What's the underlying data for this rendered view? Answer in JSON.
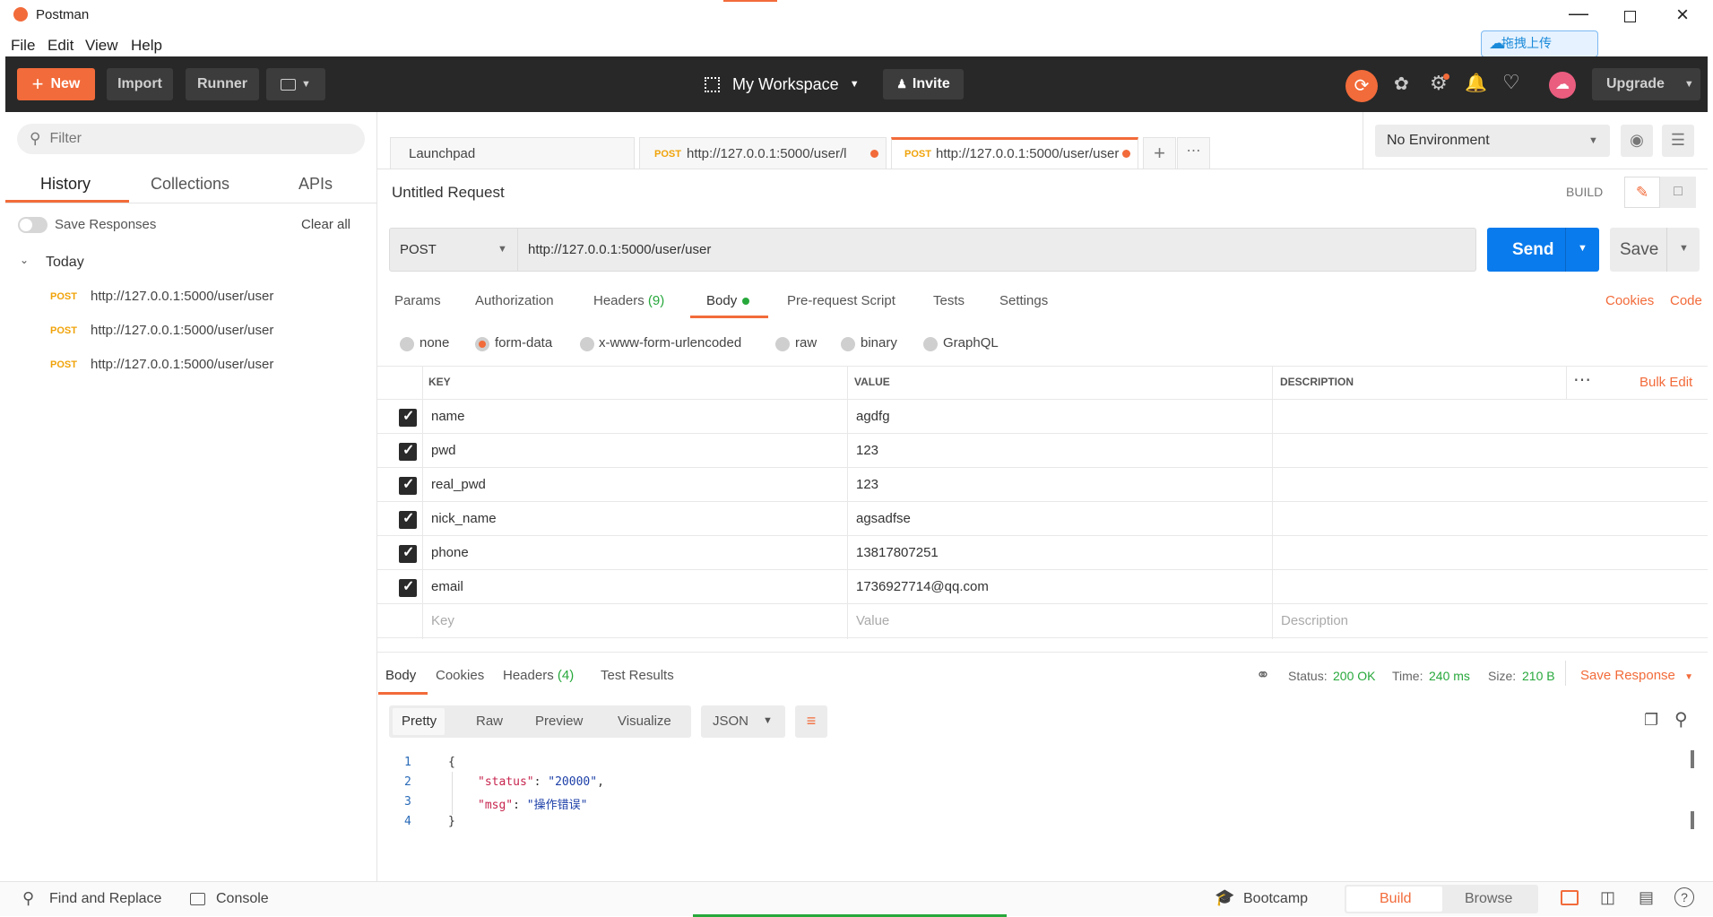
{
  "window": {
    "title": "Postman"
  },
  "menu": [
    "File",
    "Edit",
    "View",
    "Help"
  ],
  "upload_badge": "拖拽上传",
  "toolbar": {
    "new_label": "New",
    "import_label": "Import",
    "runner_label": "Runner",
    "workspace_label": "My Workspace",
    "invite_label": "Invite",
    "upgrade_label": "Upgrade"
  },
  "sidebar": {
    "filter_placeholder": "Filter",
    "tabs": [
      "History",
      "Collections",
      "APIs"
    ],
    "save_responses_label": "Save Responses",
    "clear_all_label": "Clear all",
    "group_label": "Today",
    "history": [
      {
        "method": "POST",
        "url": "http://127.0.0.1:5000/user/user"
      },
      {
        "method": "POST",
        "url": "http://127.0.0.1:5000/user/user"
      },
      {
        "method": "POST",
        "url": "http://127.0.0.1:5000/user/user"
      }
    ]
  },
  "tabs": [
    {
      "label": "Launchpad"
    },
    {
      "method": "POST",
      "label": "http://127.0.0.1:5000/user/l"
    },
    {
      "method": "POST",
      "label": "http://127.0.0.1:5000/user/user"
    }
  ],
  "environment": {
    "selected": "No Environment"
  },
  "request": {
    "name": "Untitled Request",
    "build_label": "BUILD",
    "method": "POST",
    "url": "http://127.0.0.1:5000/user/user",
    "send_label": "Send",
    "save_label": "Save"
  },
  "request_tabs": {
    "params": "Params",
    "authorization": "Authorization",
    "headers": "Headers",
    "headers_count": "(9)",
    "body": "Body",
    "prerequest": "Pre-request Script",
    "tests": "Tests",
    "settings": "Settings",
    "cookies": "Cookies",
    "code": "Code"
  },
  "body_types": [
    "none",
    "form-data",
    "x-www-form-urlencoded",
    "raw",
    "binary",
    "GraphQL"
  ],
  "form_table": {
    "headers": {
      "key": "KEY",
      "value": "VALUE",
      "description": "DESCRIPTION"
    },
    "bulk_edit_label": "Bulk Edit",
    "rows": [
      {
        "key": "name",
        "value": "agdfg"
      },
      {
        "key": "pwd",
        "value": "123"
      },
      {
        "key": "real_pwd",
        "value": "123"
      },
      {
        "key": "nick_name",
        "value": "agsadfse"
      },
      {
        "key": "phone",
        "value": "13817807251"
      },
      {
        "key": "email",
        "value": "1736927714@qq.com"
      }
    ],
    "placeholders": {
      "key": "Key",
      "value": "Value",
      "description": "Description"
    }
  },
  "response": {
    "tabs": {
      "body": "Body",
      "cookies": "Cookies",
      "headers": "Headers",
      "headers_count": "(4)",
      "test_results": "Test Results"
    },
    "status_label": "Status:",
    "status_value": "200 OK",
    "time_label": "Time:",
    "time_value": "240 ms",
    "size_label": "Size:",
    "size_value": "210 B",
    "save_response_label": "Save Response",
    "view_modes": [
      "Pretty",
      "Raw",
      "Preview",
      "Visualize"
    ],
    "format": "JSON",
    "code_lines": [
      {
        "num": "1",
        "text": "{"
      },
      {
        "num": "2",
        "key": "\"status\"",
        "value": "\"20000\"",
        "trail": ","
      },
      {
        "num": "3",
        "key": "\"msg\"",
        "value": "\"操作错误\"",
        "trail": ""
      },
      {
        "num": "4",
        "text": "}"
      }
    ]
  },
  "statusbar": {
    "find_replace": "Find and Replace",
    "console": "Console",
    "bootcamp": "Bootcamp",
    "build": "Build",
    "browse": "Browse"
  },
  "colors": {
    "accent": "#f26b3a",
    "send_blue": "#097bed",
    "status_green": "#27a83b",
    "dark_bar": "#282828"
  }
}
